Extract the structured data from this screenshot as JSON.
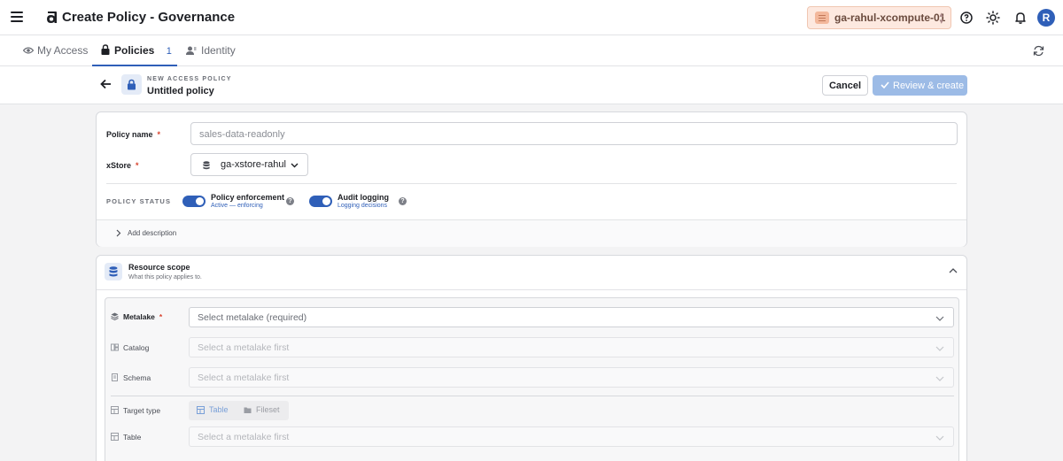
{
  "topbar": {
    "title": "Create Policy - Governance",
    "environment": "ga-rahul-xcompute-01",
    "avatar_initial": "R",
    "icons": [
      "menu-icon",
      "logo-icon",
      "database-icon",
      "help-icon",
      "theme-icon",
      "bell-icon"
    ]
  },
  "tabs": [
    {
      "label": "My Access",
      "icon": "eye-icon"
    },
    {
      "label": "Policies",
      "icon": "lock-icon",
      "badge": "1",
      "active": true
    },
    {
      "label": "Identity",
      "icon": "user-icon"
    }
  ],
  "header": {
    "eyebrow": "NEW ACCESS POLICY",
    "title": "Untitled policy",
    "cancel_label": "Cancel",
    "review_label": "Review & create"
  },
  "general": {
    "policy_name_label": "Policy name",
    "policy_name_placeholder": "sales-data-readonly",
    "xstore_label": "xStore",
    "xstore_value": "ga-xstore-rahul",
    "required_mark": "*",
    "status_label": "POLICY STATUS",
    "enforcement": {
      "title": "Policy enforcement",
      "subtitle": "Active — enforcing",
      "on": true
    },
    "audit": {
      "title": "Audit logging",
      "subtitle": "Logging decisions",
      "on": true
    },
    "help_mark": "?",
    "add_description": "Add description"
  },
  "resource_scope": {
    "title": "Resource scope",
    "subtitle": "What this policy applies to.",
    "rows": {
      "metalake": {
        "label": "Metalake",
        "placeholder": "Select metalake (required)"
      },
      "catalog": {
        "label": "Catalog",
        "placeholder": "Select a metalake first"
      },
      "schema": {
        "label": "Schema",
        "placeholder": "Select a metalake first"
      },
      "target_type": {
        "label": "Target type",
        "options": [
          "Table",
          "Fileset"
        ],
        "selected": "Table"
      },
      "table": {
        "label": "Table",
        "placeholder": "Select a metalake first"
      }
    }
  },
  "colors": {
    "accent": "#2f5fb8",
    "required": "#d8442f",
    "env_bg": "#fde9e0"
  }
}
